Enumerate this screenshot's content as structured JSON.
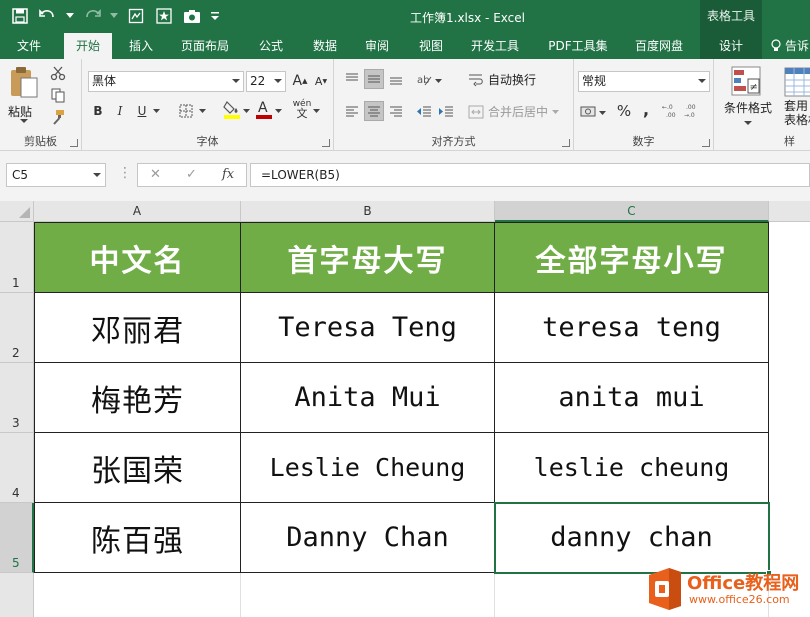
{
  "window": {
    "title": "工作簿1.xlsx - Excel",
    "context_tab_group": "表格工具"
  },
  "ribbon_tabs": [
    "文件",
    "开始",
    "插入",
    "页面布局",
    "公式",
    "数据",
    "审阅",
    "视图",
    "开发工具",
    "PDF工具集",
    "百度网盘",
    "设计",
    "告诉"
  ],
  "ribbon": {
    "clipboard": {
      "paste_label": "粘贴",
      "group_label": "剪贴板"
    },
    "font": {
      "font_name": "黑体",
      "font_size": "22",
      "group_label": "字体",
      "bold": "B",
      "italic": "I",
      "underline": "U",
      "grow": "A",
      "shrink": "A",
      "wen": "wén"
    },
    "alignment": {
      "wrap_label": "自动换行",
      "merge_label": "合并后居中",
      "group_label": "对齐方式"
    },
    "number": {
      "format": "常规",
      "group_label": "数字"
    },
    "styles": {
      "cond_format_label": "条件格式",
      "table_format_label": "套用\n表格格",
      "group_label": "样"
    }
  },
  "formula_bar": {
    "name_box": "C5",
    "cancel": "✕",
    "enter": "✓",
    "fx": "fx",
    "formula": "=LOWER(B5)"
  },
  "sheet": {
    "columns": [
      "A",
      "B",
      "C"
    ],
    "rows": [
      "1",
      "2",
      "3",
      "4",
      "5"
    ],
    "header": [
      "中文名",
      "首字母大写",
      "全部字母小写"
    ],
    "data": [
      [
        "邓丽君",
        "Teresa Teng",
        "teresa teng"
      ],
      [
        "梅艳芳",
        "Anita Mui",
        "anita mui"
      ],
      [
        "张国荣",
        "Leslie Cheung",
        "leslie cheung"
      ],
      [
        "陈百强",
        "Danny Chan",
        "danny chan"
      ]
    ],
    "active_cell": "C5"
  },
  "watermark": {
    "brand": "Office教程网",
    "url": "www.office26.com"
  },
  "colors": {
    "excel_green": "#217346",
    "header_fill": "#70ad47",
    "watermark_orange": "#e8601c"
  }
}
